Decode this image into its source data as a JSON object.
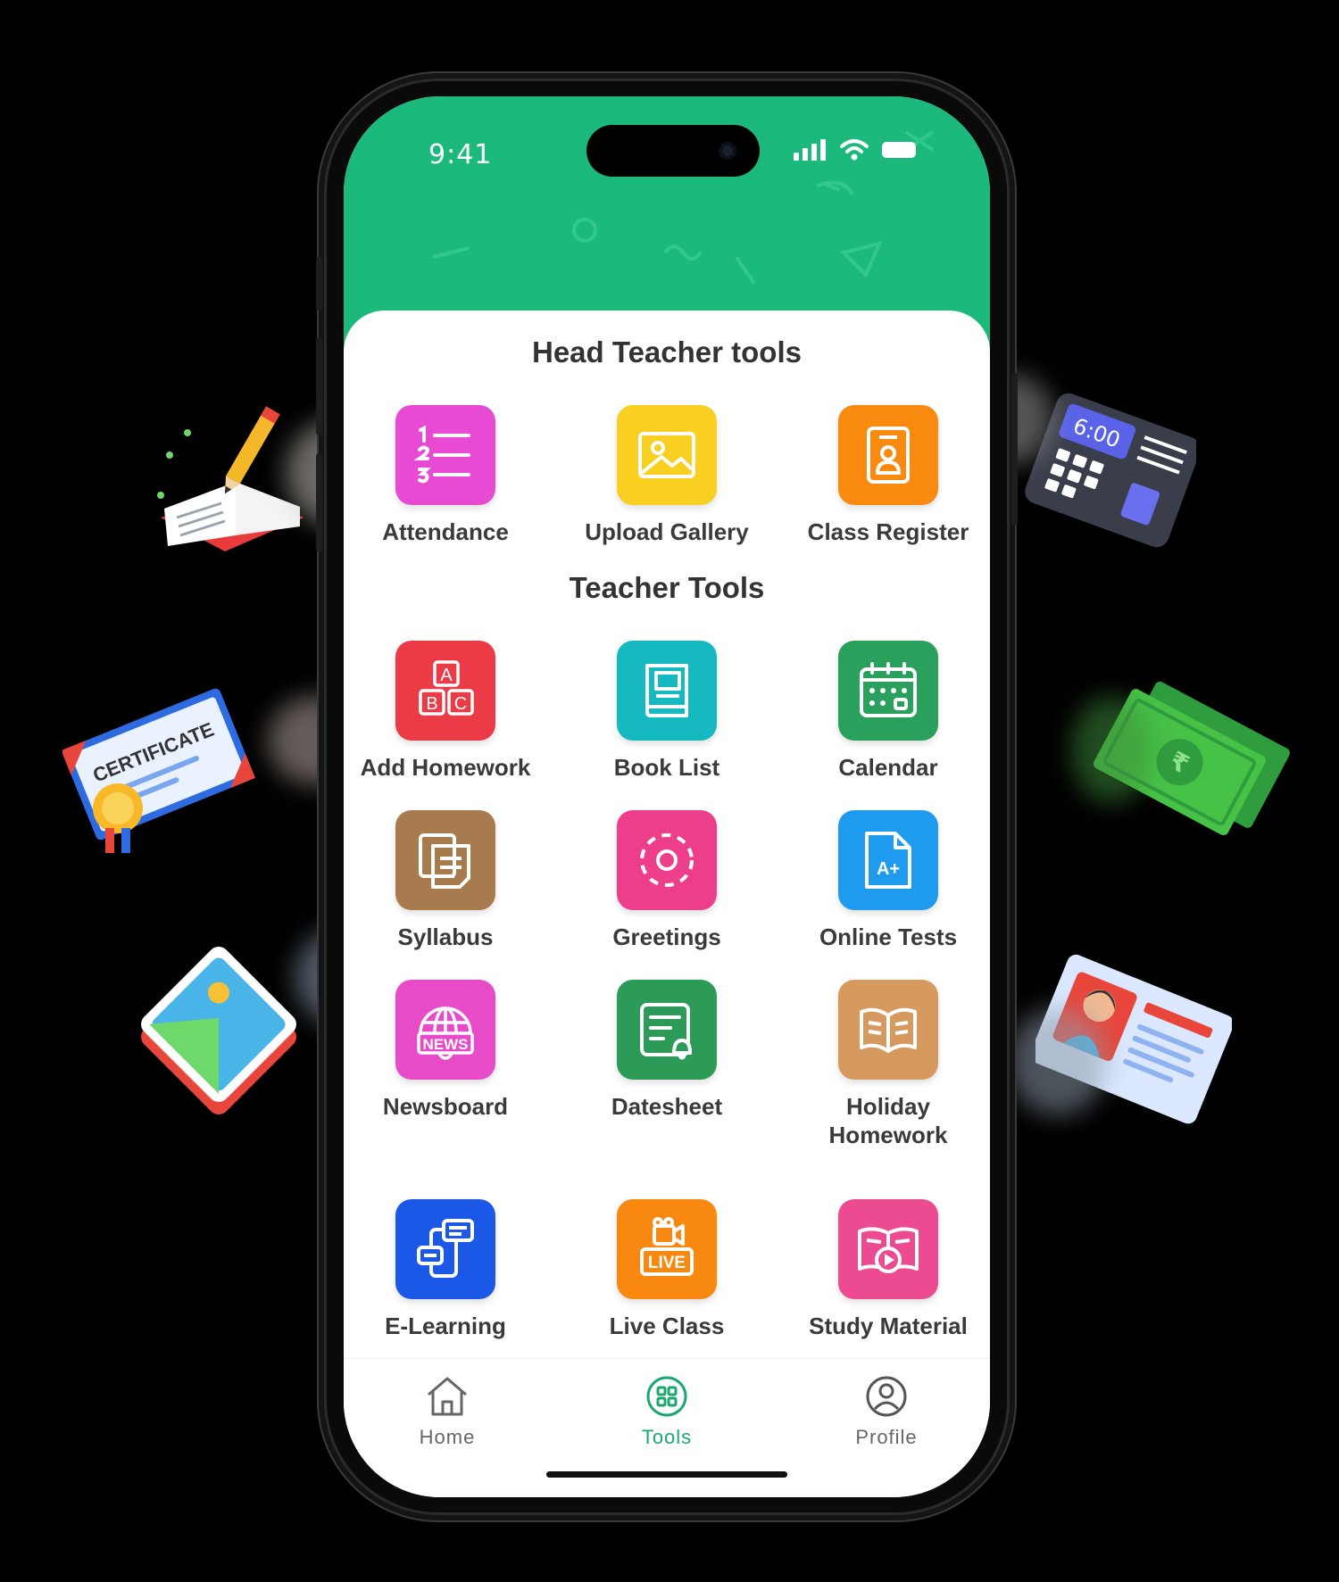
{
  "status_bar": {
    "time": "9:41"
  },
  "sections": {
    "head_teacher": {
      "title": "Head Teacher tools",
      "tools": [
        {
          "label": "Attendance",
          "color": "#e94ad3",
          "icon": "numbered-list-icon"
        },
        {
          "label": "Upload Gallery",
          "color": "#f9cf21",
          "icon": "image-icon"
        },
        {
          "label": "Class Register",
          "color": "#f98a0f",
          "icon": "register-icon"
        }
      ]
    },
    "teacher": {
      "title": "Teacher Tools",
      "tools": [
        {
          "label": "Add Homework",
          "color": "#ea3b47",
          "icon": "abc-blocks-icon"
        },
        {
          "label": "Book List",
          "color": "#17b9c0",
          "icon": "book-icon"
        },
        {
          "label": "Calendar",
          "color": "#2aa05d",
          "icon": "calendar-icon"
        },
        {
          "label": "Syllabus",
          "color": "#a77b4d",
          "icon": "documents-icon"
        },
        {
          "label": "Greetings",
          "color": "#ed3e8c",
          "icon": "greeting-circle-icon"
        },
        {
          "label": "Online Tests",
          "color": "#1e9bef",
          "icon": "test-file-icon"
        },
        {
          "label": "Newsboard",
          "color": "#e84bc8",
          "icon": "news-globe-icon"
        },
        {
          "label": "Datesheet",
          "color": "#2c9b58",
          "icon": "datesheet-bell-icon"
        },
        {
          "label": "Holiday Homework",
          "color": "#d69a5e",
          "icon": "open-book-icon"
        },
        {
          "label": "E-Learning",
          "color": "#1b58e8",
          "icon": "elearning-chat-icon"
        },
        {
          "label": "Live Class",
          "color": "#f8880f",
          "icon": "live-camera-icon"
        },
        {
          "label": "Study Material",
          "color": "#ec4b92",
          "icon": "study-video-icon"
        }
      ]
    }
  },
  "icon_text": {
    "abc_a": "A",
    "abc_b": "B",
    "abc_c": "C",
    "test_grade": "A+",
    "news": "NEWS",
    "live": "LIVE"
  },
  "tabbar": {
    "items": [
      {
        "label": "Home",
        "icon": "home-icon"
      },
      {
        "label": "Tools",
        "icon": "grid-icon",
        "active": true
      },
      {
        "label": "Profile",
        "icon": "user-icon"
      }
    ],
    "active_color": "#1aa86e"
  },
  "decorations": {
    "certificate_text": "CERTIFICATE",
    "clock_text": "6:00"
  },
  "colors": {
    "header": "#1cb97c",
    "background": "#000000"
  }
}
